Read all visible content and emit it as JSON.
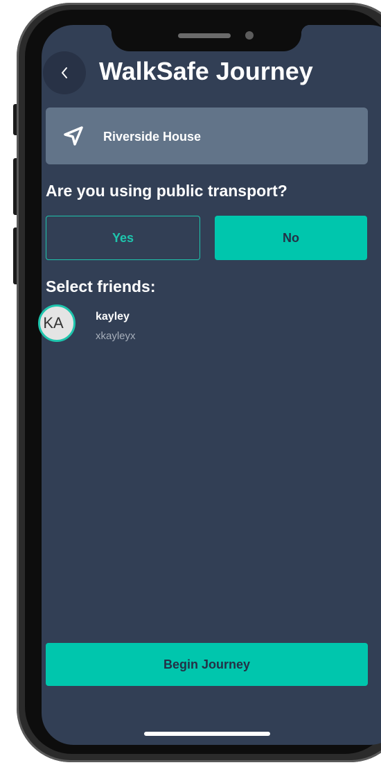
{
  "header": {
    "back_icon": "chevron-left-icon",
    "title": "WalkSafe Journey"
  },
  "destination": {
    "icon": "navigation-arrow-icon",
    "label": "Riverside House"
  },
  "transport": {
    "question": "Are you using public transport?",
    "options": [
      {
        "label": "Yes",
        "selected": false
      },
      {
        "label": "No",
        "selected": true
      }
    ]
  },
  "friends": {
    "heading": "Select friends:",
    "items": [
      {
        "initials": "KA",
        "name": "kayley",
        "username": "xkayleyx"
      }
    ]
  },
  "actions": {
    "begin_label": "Begin Journey"
  },
  "colors": {
    "background": "#323f55",
    "accent": "#00c6ad",
    "card": "#627489",
    "text": "#ffffff",
    "muted": "#a6aeba"
  }
}
